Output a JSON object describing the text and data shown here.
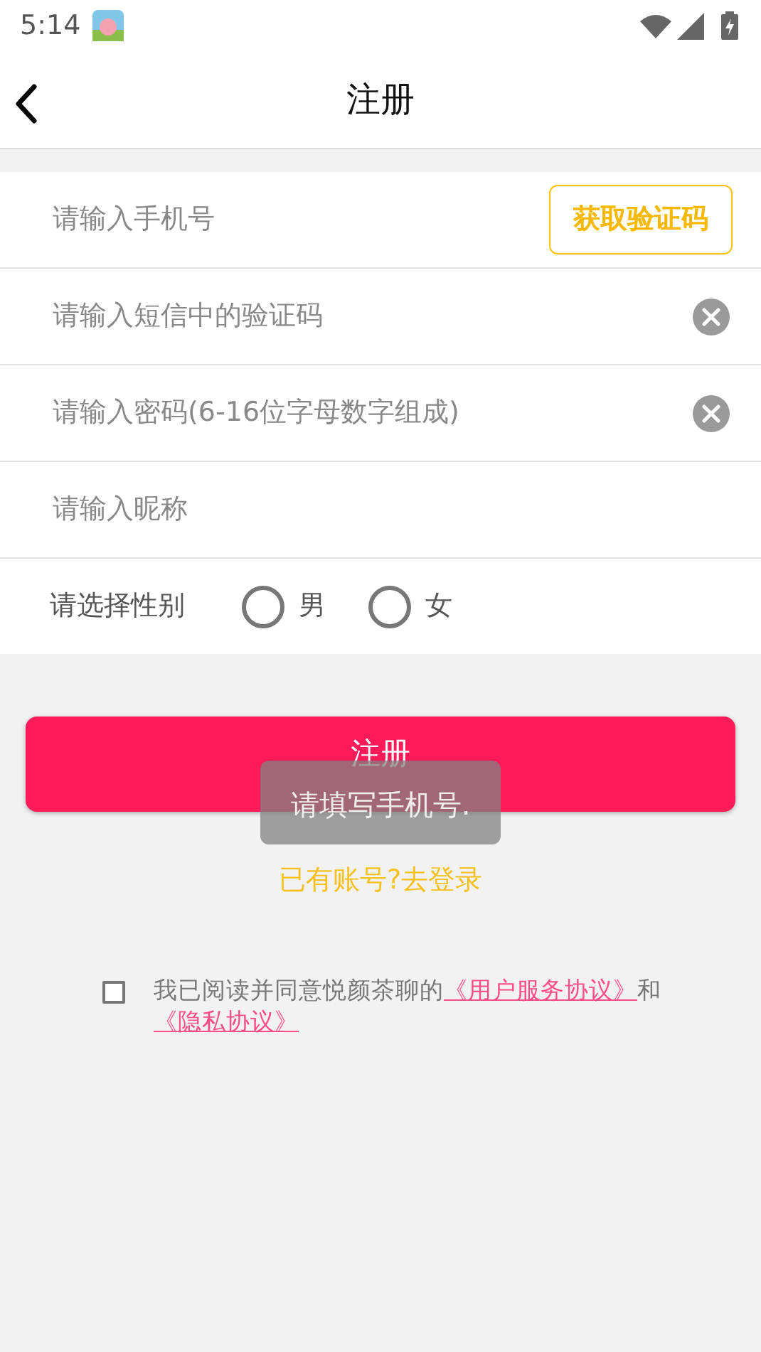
{
  "status_bar": {
    "time": "5:14"
  },
  "header": {
    "title": "注册"
  },
  "fields": [
    {
      "kind": "input",
      "placeholder": "请输入手机号",
      "clearable": false,
      "action": "获取验证码"
    },
    {
      "kind": "input",
      "placeholder": "请输入短信中的验证码",
      "clearable": true
    },
    {
      "kind": "input",
      "placeholder": "请输入密码(6-16位字母数字组成)",
      "clearable": true
    },
    {
      "kind": "input",
      "placeholder": "请输入昵称",
      "clearable": false
    },
    {
      "kind": "radio",
      "label": "请选择性别",
      "options": [
        {
          "label": "男",
          "selected": false
        },
        {
          "label": "女",
          "selected": false
        }
      ]
    }
  ],
  "submit": "注册",
  "toast": "请填写手机号.",
  "login_link": "已有账号?去登录",
  "agreement": {
    "checked": false,
    "parts": [
      {
        "kind": "text",
        "text": "我已阅读并同意悦颜茶聊的"
      },
      {
        "kind": "link",
        "text": "《用户服务协议》"
      },
      {
        "kind": "text",
        "text": "和"
      },
      {
        "kind": "link",
        "text": "《隐私协议》"
      }
    ]
  }
}
